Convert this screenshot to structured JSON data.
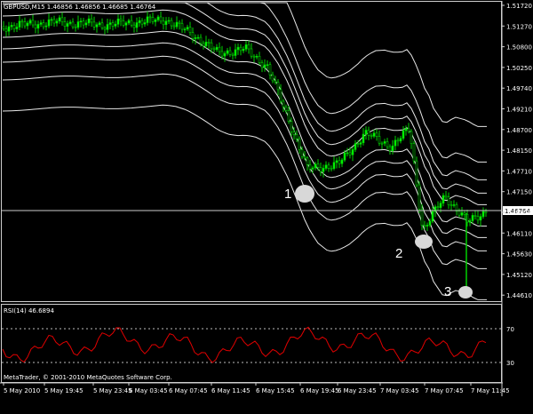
{
  "window": {
    "header": "GBPUSD,M15 1.46856 1.46856 1.46685 1.46764",
    "footer": "MetaTrader, © 2001-2010 MetaQuotes Software Corp."
  },
  "main_chart": {
    "y_ticks": [
      "1.51720",
      "1.51270",
      "1.50800",
      "1.50250",
      "1.49740",
      "1.49210",
      "1.48700",
      "1.48150",
      "1.47710",
      "1.47150",
      "1.46610",
      "1.46110",
      "1.45630",
      "1.45120",
      "1.44610"
    ],
    "current_price": "1.46764",
    "markers": [
      {
        "label": "1"
      },
      {
        "label": "2"
      },
      {
        "label": "3"
      }
    ]
  },
  "rsi_panel": {
    "title": "RSI(14) 46.6894",
    "level_high": "70",
    "level_low": "30"
  },
  "x_axis": {
    "labels": [
      "5 May 2010",
      "5 May 19:45",
      "5 May 23:45",
      "6 May 03:45",
      "6 May 07:45",
      "6 May 11:45",
      "6 May 15:45",
      "6 May 19:45",
      "6 May 23:45",
      "7 May 03:45",
      "7 May 07:45",
      "7 May 11:45"
    ]
  },
  "colors": {
    "background": "#000000",
    "candles": "#00d000",
    "envelope": "#ffffff",
    "rsi_line": "#e00000"
  }
}
